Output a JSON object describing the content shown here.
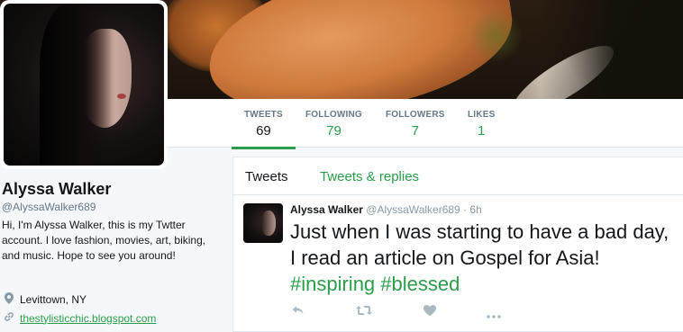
{
  "stats": [
    {
      "label": "TWEETS",
      "value": "69"
    },
    {
      "label": "FOLLOWING",
      "value": "79"
    },
    {
      "label": "FOLLOWERS",
      "value": "7"
    },
    {
      "label": "LIKES",
      "value": "1"
    }
  ],
  "profile": {
    "name": "Alyssa Walker",
    "handle": "@AlyssaWalker689",
    "bio": "Hi, I'm Alyssa Walker, this is my Twtter account. I love fashion, movies, art, biking, and music. Hope to see you around!",
    "location": "Levittown, NY",
    "website": "thestylisticchic.blogspot.com"
  },
  "tabs": {
    "tweets": "Tweets",
    "replies": "Tweets & replies"
  },
  "tweet": {
    "name": "Alyssa Walker",
    "handle": "@AlyssaWalker689",
    "separator": "·",
    "time": "6h",
    "text": "Just when I was starting to have a bad day, I read an article on Gospel for Asia!",
    "hashtag1": "#inspiring",
    "hashtag2": "#blessed"
  },
  "icons": {
    "location": "map-pin-icon",
    "link": "link-icon",
    "reply": "reply-icon",
    "retweet": "retweet-icon",
    "like": "heart-icon",
    "more": "more-icon"
  },
  "colors": {
    "accent": "#2a9d4a",
    "muted": "#657786"
  }
}
